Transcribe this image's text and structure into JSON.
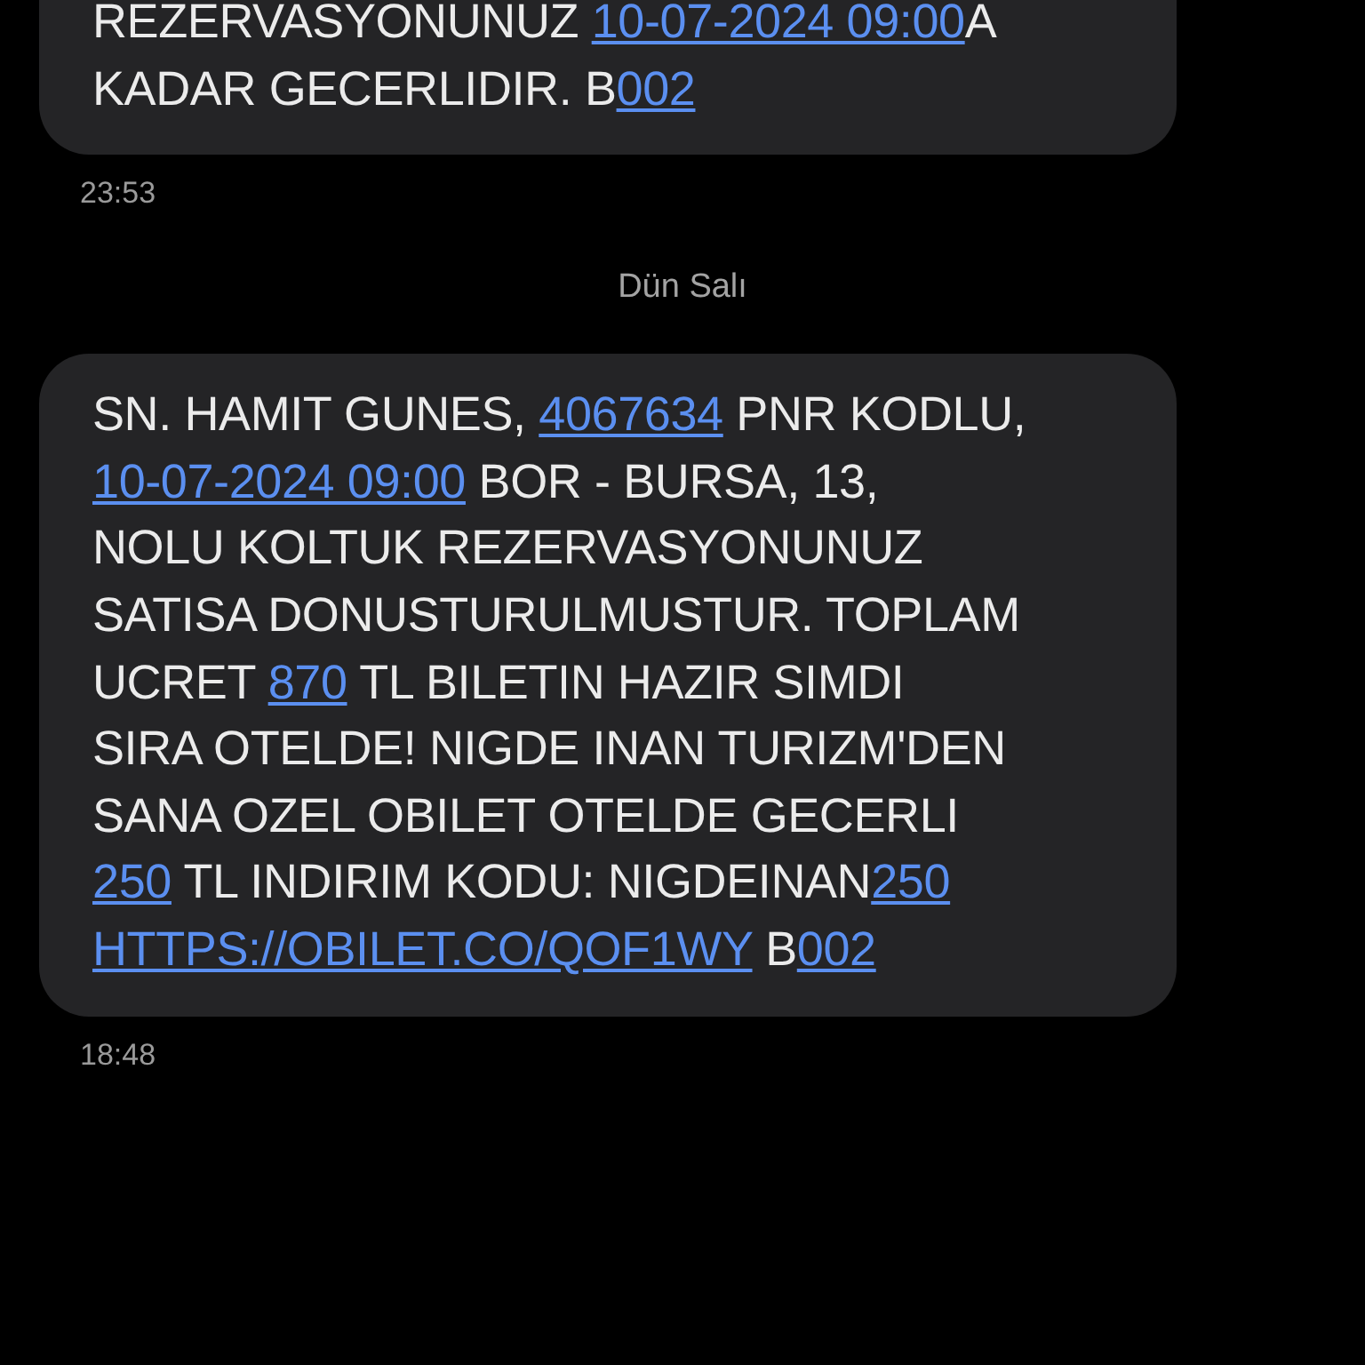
{
  "thread": [
    {
      "kind": "message",
      "lines": [
        [
          {
            "kind": "text",
            "text": "REZERVASYONUNUZ "
          },
          {
            "kind": "link",
            "text": "10-07-2024 09:00"
          },
          {
            "kind": "text",
            "text": "A"
          }
        ],
        [
          {
            "kind": "text",
            "text": "KADAR GECERLIDIR. B"
          },
          {
            "kind": "link",
            "text": "002"
          }
        ]
      ],
      "time": "23:53"
    },
    {
      "kind": "date",
      "text": "Dün Salı"
    },
    {
      "kind": "message",
      "lines": [
        [
          {
            "kind": "text",
            "text": "SN. HAMIT GUNES, "
          },
          {
            "kind": "link",
            "text": "4067634"
          },
          {
            "kind": "text",
            "text": " PNR KODLU,"
          }
        ],
        [
          {
            "kind": "link",
            "text": "10-07-2024 09:00"
          },
          {
            "kind": "text",
            "text": " BOR - BURSA, 13,"
          }
        ],
        [
          {
            "kind": "text",
            "text": "NOLU KOLTUK REZERVASYONUNUZ"
          }
        ],
        [
          {
            "kind": "text",
            "text": "SATISA DONUSTURULMUSTUR. TOPLAM"
          }
        ],
        [
          {
            "kind": "text",
            "text": "UCRET "
          },
          {
            "kind": "link",
            "text": "870"
          },
          {
            "kind": "text",
            "text": " TL BILETIN HAZIR SIMDI"
          }
        ],
        [
          {
            "kind": "text",
            "text": "SIRA OTELDE! NIGDE INAN TURIZM'DEN"
          }
        ],
        [
          {
            "kind": "text",
            "text": "SANA OZEL OBILET OTELDE GECERLI"
          }
        ],
        [
          {
            "kind": "link",
            "text": "250"
          },
          {
            "kind": "text",
            "text": " TL INDIRIM KODU: NIGDEINAN"
          },
          {
            "kind": "link",
            "text": "250"
          }
        ],
        [
          {
            "kind": "link",
            "text": "HTTPS://OBILET.CO/QOF1WY"
          },
          {
            "kind": "text",
            "text": " B"
          },
          {
            "kind": "link",
            "text": "002"
          }
        ]
      ],
      "time": "18:48"
    }
  ]
}
